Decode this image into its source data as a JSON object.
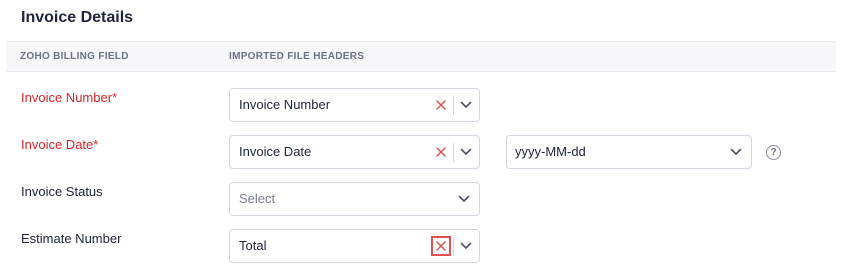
{
  "section": {
    "title": "Invoice Details"
  },
  "columns": {
    "billing_field": "ZOHO BILLING FIELD",
    "imported_headers": "IMPORTED FILE HEADERS"
  },
  "rows": [
    {
      "label": "Invoice Number*",
      "required": true,
      "value": "Invoice Number",
      "clearable": true
    },
    {
      "label": "Invoice Date*",
      "required": true,
      "value": "Invoice Date",
      "clearable": true,
      "date_format": "yyyy-MM-dd"
    },
    {
      "label": "Invoice Status",
      "required": false,
      "value": "Select",
      "placeholder": true,
      "clearable": false
    },
    {
      "label": "Estimate Number",
      "required": false,
      "value": "Total",
      "clearable": true,
      "clear_focused": true
    }
  ],
  "help": {
    "glyph": "?"
  },
  "colors": {
    "required": "#d6262a",
    "clear_icon": "#e05252",
    "border": "#d5d7e0",
    "header_bg": "#f7f7f9"
  },
  "icons": {
    "clear": "close-icon",
    "dropdown": "chevron-down-icon",
    "help": "question-circle-icon"
  }
}
